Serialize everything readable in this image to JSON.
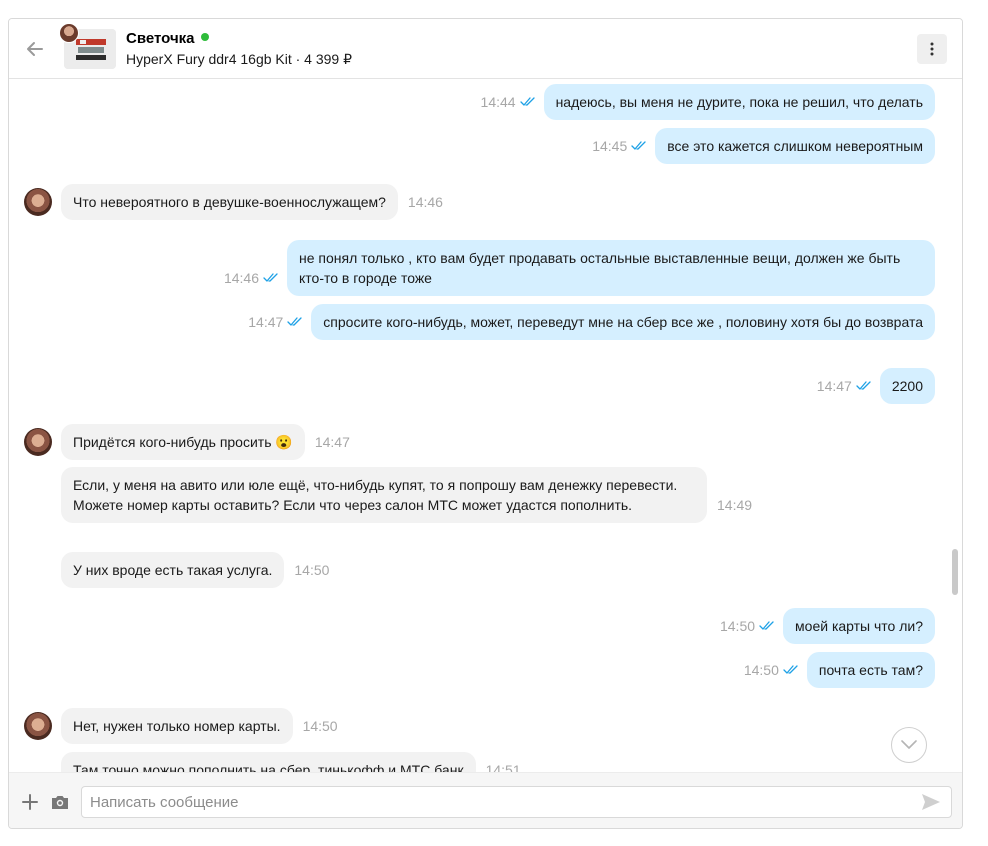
{
  "header": {
    "contact_name": "Светочка",
    "item_line": "HyperX Fury ddr4 16gb Kit · 4 399 ₽"
  },
  "messages": [
    {
      "dir": "out",
      "text": "надеюсь, вы меня не дурите, пока не решил, что делать",
      "time": "14:44"
    },
    {
      "dir": "out",
      "text": "все это кажется слишком невероятным",
      "time": "14:45"
    },
    {
      "dir": "in",
      "text": "Что невероятного в девушке-военнослужащем?",
      "time": "14:46",
      "avatar": true
    },
    {
      "dir": "out",
      "text": "не понял только , кто вам будет продавать остальные выставленные вещи, должен же быть кто-то в городе тоже",
      "time": "14:46"
    },
    {
      "dir": "out",
      "text": "спросите кого-нибудь, может, переведут мне на сбер все же , половину хотя бы до возврата",
      "time": "14:47"
    },
    {
      "dir": "out",
      "text": "2200",
      "time": "14:47"
    },
    {
      "dir": "in",
      "text": "Придётся кого-нибудь просить 😮",
      "time": "14:47",
      "avatar": true
    },
    {
      "dir": "in",
      "text": "Если, у меня на авито или юле ещё, что-нибудь купят, то я попрошу вам денежку перевести. Можете номер карты оставить? Если что через салон МТС может удастся пополнить.",
      "time": "14:49"
    },
    {
      "dir": "in",
      "text": "У них вроде есть такая услуга.",
      "time": "14:50"
    },
    {
      "dir": "out",
      "text": "моей карты что ли?",
      "time": "14:50"
    },
    {
      "dir": "out",
      "text": "почта есть там?",
      "time": "14:50"
    },
    {
      "dir": "in",
      "text": "Нет, нужен только номер карты.",
      "time": "14:50",
      "avatar": true
    },
    {
      "dir": "in",
      "text": "Там точно можно пополнить на сбер, тинькофф и МТС банк",
      "time": "14:51"
    }
  ],
  "composer": {
    "placeholder": "Написать сообщение"
  },
  "colors": {
    "outgoing_bubble": "#d5efff",
    "incoming_bubble": "#f2f2f2",
    "read_ticks": "#1ea1e6",
    "online": "#2fbc3b"
  }
}
